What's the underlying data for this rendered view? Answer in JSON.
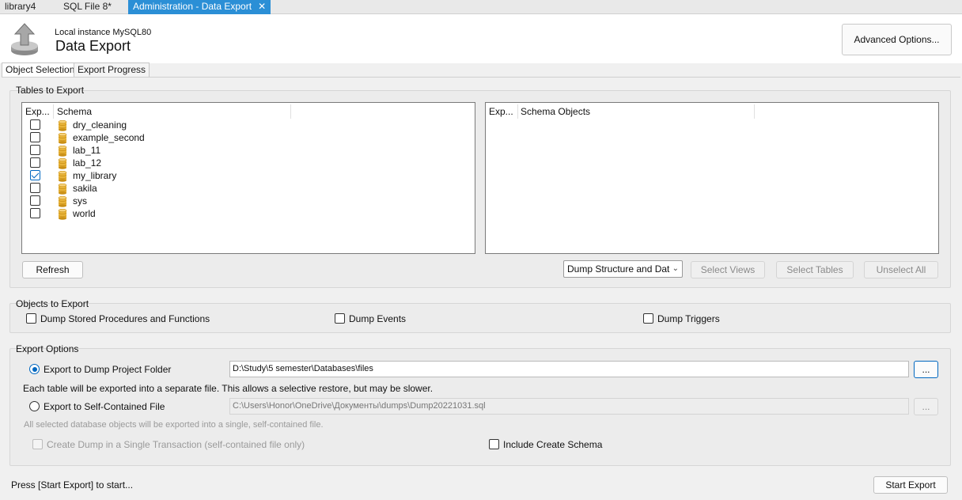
{
  "doc_tabs": [
    {
      "label": "library4"
    },
    {
      "label": "SQL File 8*"
    },
    {
      "label": "Administration - Data Export",
      "close": "✕"
    }
  ],
  "header": {
    "instance": "Local instance MySQL80",
    "title": "Data Export",
    "advanced_button": "Advanced Options...",
    "icon": "export-icon"
  },
  "page_tabs": [
    {
      "label": "Object Selection",
      "active": true
    },
    {
      "label": "Export Progress",
      "active": false
    }
  ],
  "tables_group": {
    "label": "Tables to Export",
    "schema_list": {
      "columns": [
        "Exp...",
        "Schema"
      ],
      "rows": [
        {
          "name": "dry_cleaning",
          "checked": false
        },
        {
          "name": "example_second",
          "checked": false
        },
        {
          "name": "lab_11",
          "checked": false
        },
        {
          "name": "lab_12",
          "checked": false
        },
        {
          "name": "my_library",
          "checked": true
        },
        {
          "name": "sakila",
          "checked": false
        },
        {
          "name": "sys",
          "checked": false
        },
        {
          "name": "world",
          "checked": false
        }
      ]
    },
    "objects_list": {
      "columns": [
        "Exp...",
        "Schema Objects"
      ]
    },
    "refresh_button": "Refresh",
    "dump_select": "Dump Structure and Dat",
    "select_views": "Select Views",
    "select_tables": "Select Tables",
    "unselect_all": "Unselect All"
  },
  "objects_group": {
    "label": "Objects to Export",
    "dump_procedures": "Dump Stored Procedures and Functions",
    "dump_events": "Dump Events",
    "dump_triggers": "Dump Triggers"
  },
  "export_options": {
    "label": "Export Options",
    "folder_radio": "Export to Dump Project Folder",
    "folder_path": "D:\\Study\\5 semester\\Databases\\files",
    "browse": "...",
    "folder_hint": "Each table will be exported into a separate file. This allows a selective restore, but may be slower.",
    "file_radio": "Export to Self-Contained File",
    "file_path": "C:\\Users\\Honor\\OneDrive\\Документы\\dumps\\Dump20221031.sql",
    "file_hint": "All selected database objects will be exported into a single, self-contained file.",
    "single_transaction": "Create Dump in a Single Transaction (self-contained file only)",
    "include_schema": "Include Create Schema"
  },
  "footer": {
    "status": "Press [Start Export] to start...",
    "start_button": "Start Export"
  }
}
